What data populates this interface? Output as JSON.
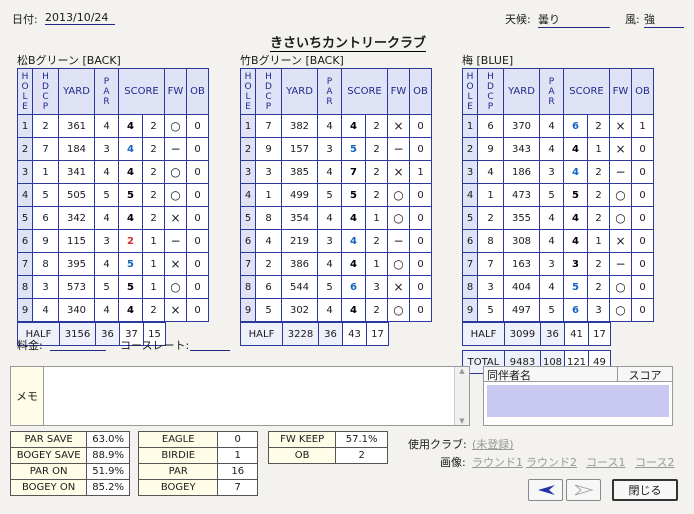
{
  "header": {
    "date_label": "日付:",
    "date": "2013/10/24",
    "title": "きさいちカントリークラブ",
    "weather_label": "天候:",
    "weather": "曇り",
    "wind_label": "風:",
    "wind": "強"
  },
  "cols": {
    "hole": "HOLE",
    "hdcp": "HDCP",
    "yard": "YARD",
    "par": "PAR",
    "score": "SCORE",
    "fw": "FW",
    "ob": "OB"
  },
  "courses": [
    {
      "name": "松Bグリーン [BACK]",
      "rows": [
        {
          "hole": "1",
          "hdcp": "2",
          "yard": "361",
          "par": "4",
          "s1": "4",
          "s2": "2",
          "fw": "○",
          "ob": "0",
          "c": "k"
        },
        {
          "hole": "2",
          "hdcp": "7",
          "yard": "184",
          "par": "3",
          "s1": "4",
          "s2": "2",
          "fw": "−",
          "ob": "0",
          "c": "b"
        },
        {
          "hole": "3",
          "hdcp": "1",
          "yard": "341",
          "par": "4",
          "s1": "4",
          "s2": "2",
          "fw": "○",
          "ob": "0",
          "c": "k"
        },
        {
          "hole": "4",
          "hdcp": "5",
          "yard": "505",
          "par": "5",
          "s1": "5",
          "s2": "2",
          "fw": "○",
          "ob": "0",
          "c": "k"
        },
        {
          "hole": "5",
          "hdcp": "6",
          "yard": "342",
          "par": "4",
          "s1": "4",
          "s2": "2",
          "fw": "×",
          "ob": "0",
          "c": "k"
        },
        {
          "hole": "6",
          "hdcp": "9",
          "yard": "115",
          "par": "3",
          "s1": "2",
          "s2": "1",
          "fw": "−",
          "ob": "0",
          "c": "r"
        },
        {
          "hole": "7",
          "hdcp": "8",
          "yard": "395",
          "par": "4",
          "s1": "5",
          "s2": "1",
          "fw": "×",
          "ob": "0",
          "c": "b"
        },
        {
          "hole": "8",
          "hdcp": "3",
          "yard": "573",
          "par": "5",
          "s1": "5",
          "s2": "1",
          "fw": "○",
          "ob": "0",
          "c": "k"
        },
        {
          "hole": "9",
          "hdcp": "4",
          "yard": "340",
          "par": "4",
          "s1": "4",
          "s2": "2",
          "fw": "×",
          "ob": "0",
          "c": "k"
        }
      ],
      "half": {
        "label": "HALF",
        "yard": "3156",
        "par": "36",
        "score": "37",
        "putts": "15"
      }
    },
    {
      "name": "竹Bグリーン [BACK]",
      "rows": [
        {
          "hole": "1",
          "hdcp": "7",
          "yard": "382",
          "par": "4",
          "s1": "4",
          "s2": "2",
          "fw": "×",
          "ob": "0",
          "c": "k"
        },
        {
          "hole": "2",
          "hdcp": "9",
          "yard": "157",
          "par": "3",
          "s1": "5",
          "s2": "2",
          "fw": "−",
          "ob": "0",
          "c": "b"
        },
        {
          "hole": "3",
          "hdcp": "3",
          "yard": "385",
          "par": "4",
          "s1": "7",
          "s2": "2",
          "fw": "×",
          "ob": "1",
          "c": "k"
        },
        {
          "hole": "4",
          "hdcp": "1",
          "yard": "499",
          "par": "5",
          "s1": "5",
          "s2": "2",
          "fw": "○",
          "ob": "0",
          "c": "k"
        },
        {
          "hole": "5",
          "hdcp": "8",
          "yard": "354",
          "par": "4",
          "s1": "4",
          "s2": "1",
          "fw": "○",
          "ob": "0",
          "c": "k"
        },
        {
          "hole": "6",
          "hdcp": "4",
          "yard": "219",
          "par": "3",
          "s1": "4",
          "s2": "2",
          "fw": "−",
          "ob": "0",
          "c": "b"
        },
        {
          "hole": "7",
          "hdcp": "2",
          "yard": "386",
          "par": "4",
          "s1": "4",
          "s2": "1",
          "fw": "○",
          "ob": "0",
          "c": "k"
        },
        {
          "hole": "8",
          "hdcp": "6",
          "yard": "544",
          "par": "5",
          "s1": "6",
          "s2": "3",
          "fw": "×",
          "ob": "0",
          "c": "b"
        },
        {
          "hole": "9",
          "hdcp": "5",
          "yard": "302",
          "par": "4",
          "s1": "4",
          "s2": "2",
          "fw": "○",
          "ob": "0",
          "c": "k"
        }
      ],
      "half": {
        "label": "HALF",
        "yard": "3228",
        "par": "36",
        "score": "43",
        "putts": "17"
      }
    },
    {
      "name": "梅 [BLUE]",
      "rows": [
        {
          "hole": "1",
          "hdcp": "6",
          "yard": "370",
          "par": "4",
          "s1": "6",
          "s2": "2",
          "fw": "×",
          "ob": "1",
          "c": "b"
        },
        {
          "hole": "2",
          "hdcp": "9",
          "yard": "343",
          "par": "4",
          "s1": "4",
          "s2": "1",
          "fw": "×",
          "ob": "0",
          "c": "k"
        },
        {
          "hole": "3",
          "hdcp": "4",
          "yard": "186",
          "par": "3",
          "s1": "4",
          "s2": "2",
          "fw": "−",
          "ob": "0",
          "c": "b"
        },
        {
          "hole": "4",
          "hdcp": "1",
          "yard": "473",
          "par": "5",
          "s1": "5",
          "s2": "2",
          "fw": "○",
          "ob": "0",
          "c": "k"
        },
        {
          "hole": "5",
          "hdcp": "2",
          "yard": "355",
          "par": "4",
          "s1": "4",
          "s2": "2",
          "fw": "○",
          "ob": "0",
          "c": "k"
        },
        {
          "hole": "6",
          "hdcp": "8",
          "yard": "308",
          "par": "4",
          "s1": "4",
          "s2": "1",
          "fw": "×",
          "ob": "0",
          "c": "k"
        },
        {
          "hole": "7",
          "hdcp": "7",
          "yard": "163",
          "par": "3",
          "s1": "3",
          "s2": "2",
          "fw": "−",
          "ob": "0",
          "c": "k"
        },
        {
          "hole": "8",
          "hdcp": "3",
          "yard": "404",
          "par": "4",
          "s1": "5",
          "s2": "2",
          "fw": "○",
          "ob": "0",
          "c": "b"
        },
        {
          "hole": "9",
          "hdcp": "5",
          "yard": "497",
          "par": "5",
          "s1": "6",
          "s2": "3",
          "fw": "○",
          "ob": "0",
          "c": "b"
        }
      ],
      "half": {
        "label": "HALF",
        "yard": "3099",
        "par": "36",
        "score": "41",
        "putts": "17"
      },
      "total": {
        "label": "TOTAL",
        "yard": "9483",
        "par": "108",
        "score": "121",
        "putts": "49"
      }
    }
  ],
  "fee_label": "料金:",
  "rating_label": "コースレート:",
  "memo_label": "メモ",
  "companions": {
    "name_header": "同伴者名",
    "score_header": "スコア"
  },
  "stats1": [
    {
      "k": "PAR SAVE",
      "v": "63.0%"
    },
    {
      "k": "BOGEY SAVE",
      "v": "88.9%"
    },
    {
      "k": "PAR ON",
      "v": "51.9%"
    },
    {
      "k": "BOGEY ON",
      "v": "85.2%"
    }
  ],
  "stats2": [
    {
      "k": "EAGLE",
      "v": "0"
    },
    {
      "k": "BIRDIE",
      "v": "1"
    },
    {
      "k": "PAR",
      "v": "16"
    },
    {
      "k": "BOGEY",
      "v": "7"
    }
  ],
  "stats3": [
    {
      "k": "FW KEEP",
      "v": "57.1%"
    },
    {
      "k": "OB",
      "v": "2"
    }
  ],
  "club_label": "使用クラブ:",
  "club_link": "(未登録)",
  "image_label": "画像:",
  "image_links": [
    "ラウンド1",
    "ラウンド2",
    "コース1",
    "コース2"
  ],
  "close_label": "閉じる"
}
